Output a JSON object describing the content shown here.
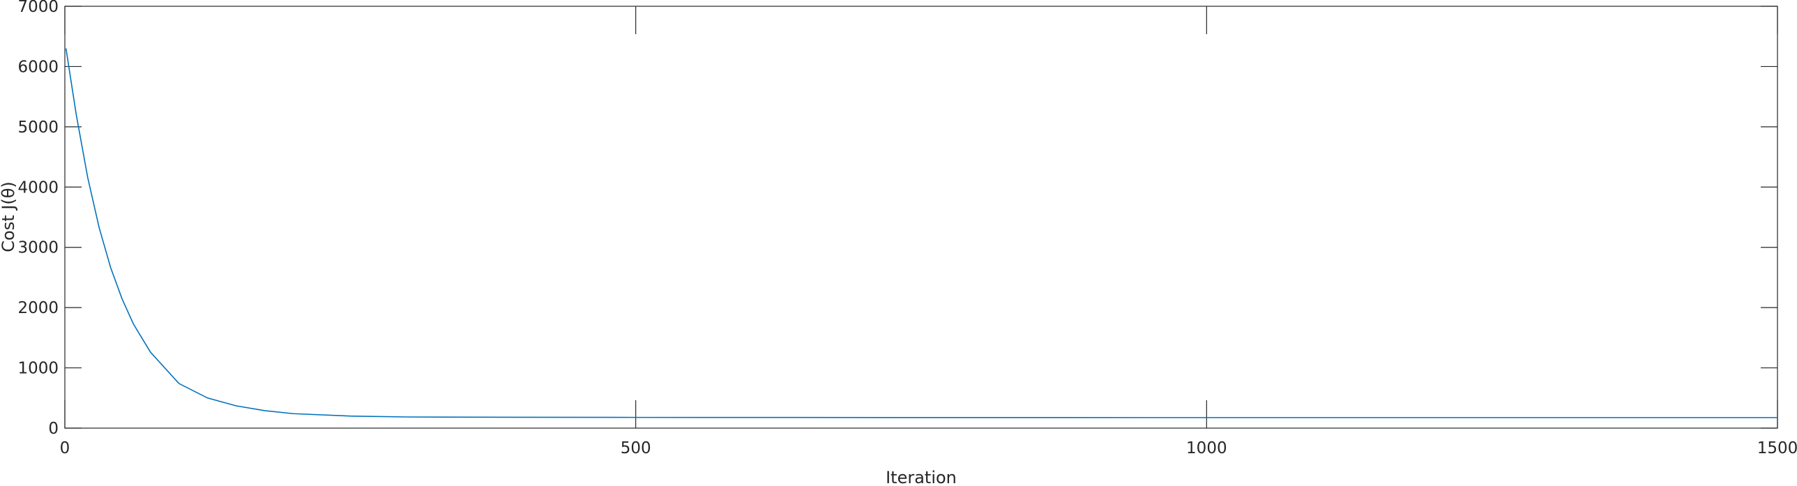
{
  "chart_data": {
    "type": "line",
    "title": "",
    "xlabel": "Iteration",
    "ylabel": "Cost J(θ)",
    "xlim": [
      0,
      1500
    ],
    "ylim": [
      0,
      7000
    ],
    "xticks": [
      0,
      500,
      1000,
      1500
    ],
    "yticks": [
      0,
      1000,
      2000,
      3000,
      4000,
      5000,
      6000,
      7000
    ],
    "xtick_labels": [
      "0",
      "500",
      "1000",
      "1500"
    ],
    "ytick_labels": [
      "0",
      "1000",
      "2000",
      "3000",
      "4000",
      "5000",
      "6000",
      "7000"
    ],
    "grid": false,
    "series": [
      {
        "color": "#0072BD",
        "x": [
          1,
          10,
          20,
          30,
          40,
          50,
          60,
          75,
          100,
          125,
          150,
          175,
          200,
          250,
          300,
          400,
          500,
          750,
          1000,
          1250,
          1500
        ],
        "y": [
          6300,
          5200,
          4160,
          3330,
          2670,
          2150,
          1730,
          1260,
          740,
          500,
          370,
          290,
          240,
          200,
          185,
          180,
          178,
          176,
          175,
          175,
          175
        ]
      }
    ]
  }
}
